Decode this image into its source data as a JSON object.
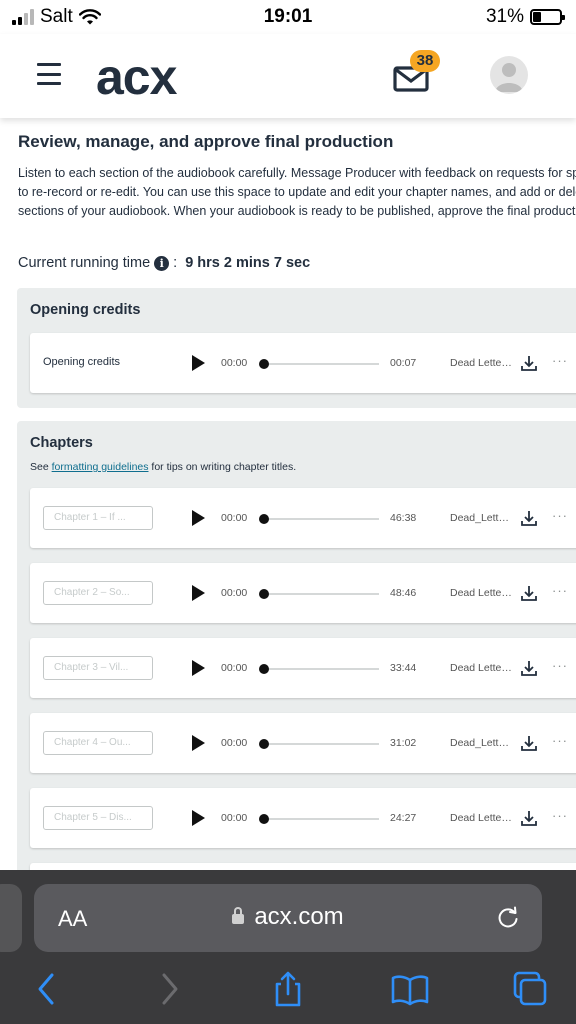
{
  "status_bar": {
    "carrier": "Salt",
    "time": "19:01",
    "battery": "31%",
    "battery_level": 0.31
  },
  "header": {
    "logo": "acx",
    "message_count": "38"
  },
  "page": {
    "title": "Review, manage, and approve final production",
    "description": "Listen to each section of the audiobook carefully. Message Producer with feedback on requests for spots to re-record or re-edit. You can use this space to update and edit your chapter names, and add or delete sections of your audiobook. When your audiobook is ready to be published, approve the final production.",
    "runtime_label": "Current running time",
    "runtime_separator": ":",
    "runtime_value": "9 hrs 2 mins 7 sec"
  },
  "opening_credits": {
    "title": "Opening credits",
    "rows": [
      {
        "label": "Opening credits",
        "start": "00:00",
        "end": "00:07",
        "file": "Dead Letters_Opening Credits.mp3"
      }
    ]
  },
  "chapters": {
    "title": "Chapters",
    "note_prefix": "See ",
    "note_link": "formatting guidelines",
    "note_suffix": " for tips on writing chapter titles.",
    "rows": [
      {
        "placeholder": "Chapter 1 – If ...",
        "start": "00:00",
        "end": "46:38",
        "file": "Dead_Letters_Ch01.mp3"
      },
      {
        "placeholder": "Chapter 2 – So...",
        "start": "00:00",
        "end": "48:46",
        "file": "Dead Letters_Ch02.mp3"
      },
      {
        "placeholder": "Chapter 3 – Vil...",
        "start": "00:00",
        "end": "33:44",
        "file": "Dead Letters_Ch03.mp3"
      },
      {
        "placeholder": "Chapter 4 – Ou...",
        "start": "00:00",
        "end": "31:02",
        "file": "Dead_Letters_Ch04.mp3"
      },
      {
        "placeholder": "Chapter 5 – Dis...",
        "start": "00:00",
        "end": "24:27",
        "file": "Dead Letters_Ch05.mp3"
      }
    ]
  },
  "browser": {
    "text_size": "AA",
    "url": "acx.com"
  },
  "colors": {
    "brand_dark": "#232f3e",
    "badge": "#f5a623",
    "link": "#0f6e8e",
    "section_bg": "#eaeded",
    "ios_blue": "#2f8ef7"
  }
}
